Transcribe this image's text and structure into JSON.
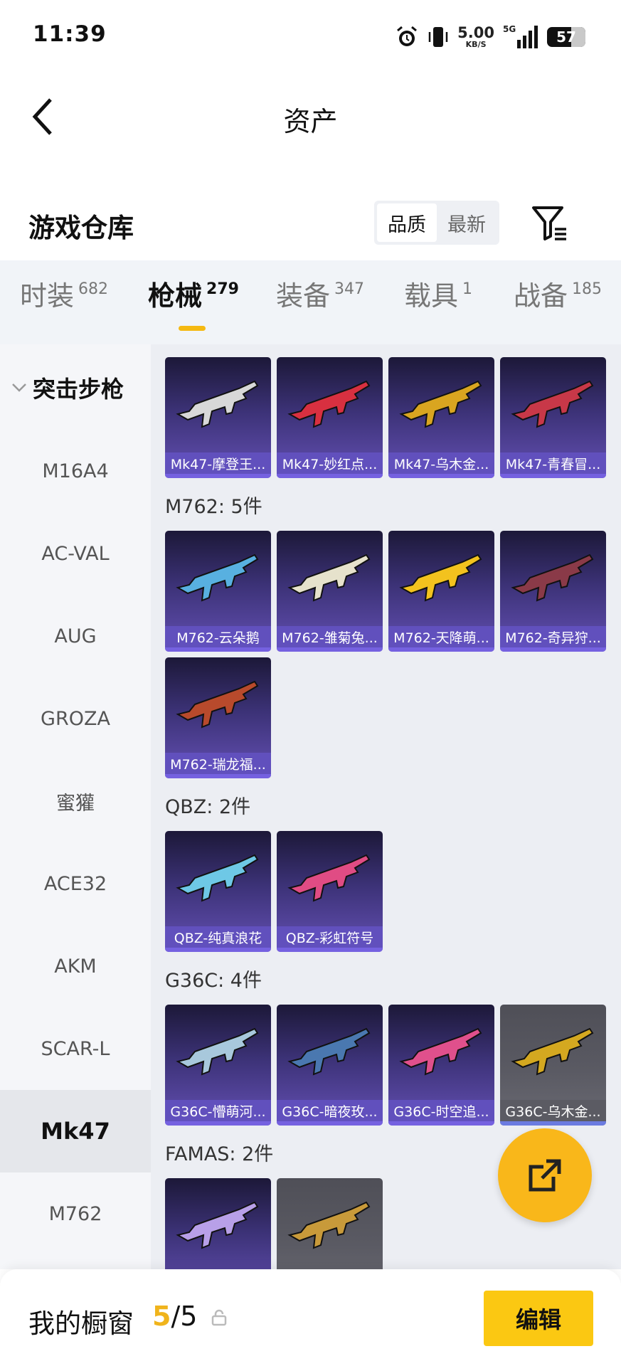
{
  "status_bar": {
    "time": "11:39",
    "net_speed": "5.00",
    "net_unit": "KB/S",
    "network": "5G",
    "battery": "57",
    "icons": [
      "alarm-icon",
      "vibrate-icon",
      "signal-icon",
      "battery-icon"
    ]
  },
  "header": {
    "title": "资产",
    "back_icon": "back-arrow-icon"
  },
  "warehouse": {
    "title": "游戏仓库",
    "sort_options": [
      {
        "label": "品质",
        "active": true
      },
      {
        "label": "最新",
        "active": false
      }
    ],
    "filter_icon": "filter-icon"
  },
  "tabs": [
    {
      "label": "时装",
      "count": "682",
      "active": false
    },
    {
      "label": "枪械",
      "count": "279",
      "active": true
    },
    {
      "label": "装备",
      "count": "347",
      "active": false
    },
    {
      "label": "载具",
      "count": "1",
      "active": false
    },
    {
      "label": "战备",
      "count": "185",
      "active": false
    }
  ],
  "sidebar": {
    "category": "突击步枪",
    "items": [
      {
        "label": "M16A4",
        "active": false
      },
      {
        "label": "AC-VAL",
        "active": false
      },
      {
        "label": "AUG",
        "active": false
      },
      {
        "label": "GROZA",
        "active": false
      },
      {
        "label": "蜜獾",
        "active": false
      },
      {
        "label": "ACE32",
        "active": false
      },
      {
        "label": "AKM",
        "active": false
      },
      {
        "label": "SCAR-L",
        "active": false
      },
      {
        "label": "Mk47",
        "active": true
      },
      {
        "label": "M762",
        "active": false
      }
    ]
  },
  "groups": [
    {
      "title": "",
      "items": [
        {
          "name": "Mk47-摩登王...",
          "color": "#d8d8d8",
          "variant": "purple"
        },
        {
          "name": "Mk47-妙红点...",
          "color": "#d83040",
          "variant": "purple"
        },
        {
          "name": "Mk47-乌木金...",
          "color": "#d9a520",
          "variant": "purple"
        },
        {
          "name": "Mk47-青春冒...",
          "color": "#c83848",
          "variant": "purple"
        }
      ]
    },
    {
      "title": "M762: 5件",
      "items": [
        {
          "name": "M762-云朵鹅",
          "color": "#58b0e0",
          "variant": "purple"
        },
        {
          "name": "M762-雏菊兔...",
          "color": "#e6e2cc",
          "variant": "purple"
        },
        {
          "name": "M762-天降萌...",
          "color": "#f3c21e",
          "variant": "purple"
        },
        {
          "name": "M762-奇异狩...",
          "color": "#8a3a48",
          "variant": "purple"
        },
        {
          "name": "M762-瑞龙福...",
          "color": "#b84a2c",
          "variant": "purple"
        }
      ]
    },
    {
      "title": "QBZ: 2件",
      "items": [
        {
          "name": "QBZ-纯真浪花",
          "color": "#6ec8e6",
          "variant": "purple"
        },
        {
          "name": "QBZ-彩虹符号",
          "color": "#e04c84",
          "variant": "purple"
        }
      ]
    },
    {
      "title": "G36C: 4件",
      "items": [
        {
          "name": "G36C-懵萌河...",
          "color": "#a8c8dc",
          "variant": "purple"
        },
        {
          "name": "G36C-暗夜玫...",
          "color": "#4a78b0",
          "variant": "purple"
        },
        {
          "name": "G36C-时空追...",
          "color": "#e0508c",
          "variant": "purple"
        },
        {
          "name": "G36C-乌木金...",
          "color": "#d4a820",
          "variant": "grey"
        }
      ]
    },
    {
      "title": "FAMAS: 2件",
      "items": [
        {
          "name": "",
          "color": "#b8a0e8",
          "variant": "purple"
        },
        {
          "name": "",
          "color": "#c89a3a",
          "variant": "grey"
        }
      ]
    }
  ],
  "fab": {
    "icon": "share-external-icon"
  },
  "bottom_bar": {
    "label": "我的橱窗",
    "current": "5",
    "separator": "/",
    "total": "5",
    "lock_icon": "lock-icon",
    "edit_label": "编辑"
  }
}
